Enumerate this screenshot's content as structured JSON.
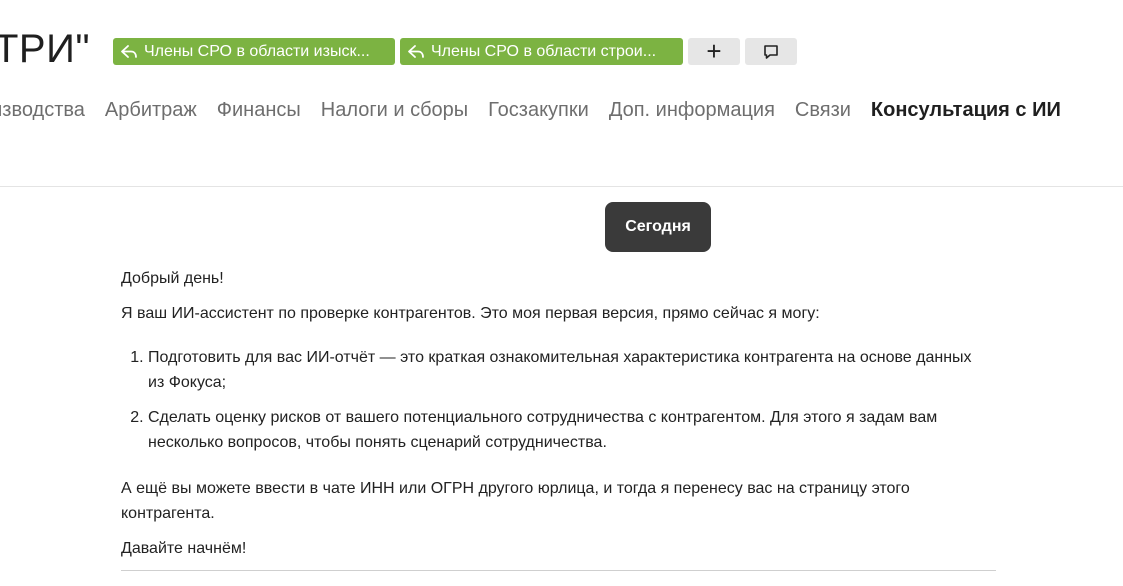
{
  "header": {
    "title": "ТРИ\"",
    "tags": [
      {
        "label": "Члены СРО в области изыск...",
        "icon": "share-arrow-icon"
      },
      {
        "label": "Члены СРО в области строи...",
        "icon": "share-arrow-icon"
      }
    ],
    "add_button_label": "+",
    "comment_icon": "comment-icon"
  },
  "nav": {
    "items": [
      "оизводства",
      "Арбитраж",
      "Финансы",
      "Налоги и сборы",
      "Госзакупки",
      "Доп. информация",
      "Связи",
      "Консультация с ИИ"
    ],
    "active_index": 7
  },
  "chat": {
    "date_badge": "Сегодня",
    "message": {
      "greeting": "Добрый день!",
      "intro": "Я ваш ИИ-ассистент по проверке контрагентов. Это моя первая версия, прямо сейчас я могу:",
      "list": [
        "Подготовить для вас ИИ-отчёт — это краткая ознакомительная характеристика контрагента на основе данных из Фокуса;",
        "Сделать оценку рисков от вашего потенциального сотрудничества с контрагентом. Для этого я задам вам несколько вопросов, чтобы понять сценарий сотрудничества."
      ],
      "extra": "А ещё вы можете ввести в чате ИНН или ОГРН другого юрлица, и тогда я перенесу вас на страницу этого контрагента.",
      "closing": "Давайте начнём!"
    }
  },
  "colors": {
    "tag_green": "#7cb342",
    "badge_dark": "#3a3a3a",
    "tool_button_bg": "#e6e6e6"
  }
}
